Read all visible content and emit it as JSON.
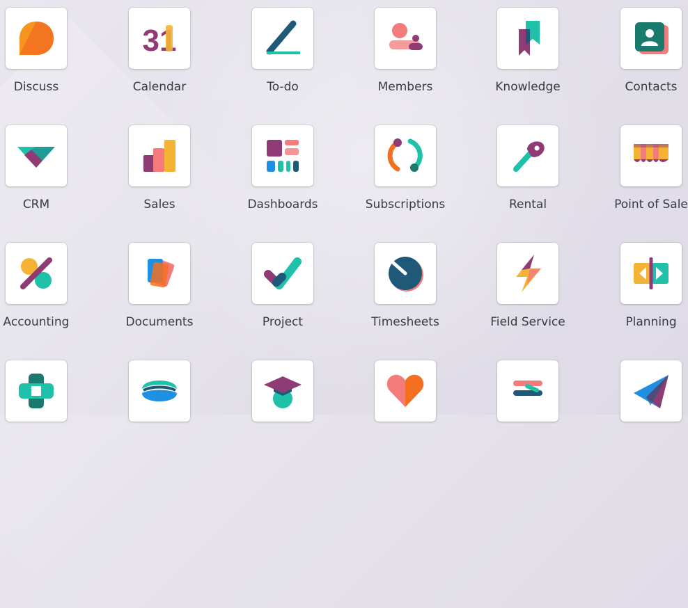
{
  "apps": [
    {
      "label": "Discuss",
      "icon": "discuss-icon"
    },
    {
      "label": "Calendar",
      "icon": "calendar-icon",
      "icon_text": "31"
    },
    {
      "label": "To-do",
      "icon": "todo-icon"
    },
    {
      "label": "Members",
      "icon": "members-icon"
    },
    {
      "label": "Knowledge",
      "icon": "knowledge-icon"
    },
    {
      "label": "Contacts",
      "icon": "contacts-icon"
    },
    {
      "label": "CRM",
      "icon": "crm-icon"
    },
    {
      "label": "Sales",
      "icon": "sales-icon"
    },
    {
      "label": "Dashboards",
      "icon": "dashboards-icon"
    },
    {
      "label": "Subscriptions",
      "icon": "subscriptions-icon"
    },
    {
      "label": "Rental",
      "icon": "rental-icon"
    },
    {
      "label": "Point of Sale",
      "icon": "point-of-sale-icon"
    },
    {
      "label": "Accounting",
      "icon": "accounting-icon"
    },
    {
      "label": "Documents",
      "icon": "documents-icon"
    },
    {
      "label": "Project",
      "icon": "project-icon"
    },
    {
      "label": "Timesheets",
      "icon": "timesheets-icon"
    },
    {
      "label": "Field Service",
      "icon": "field-service-icon"
    },
    {
      "label": "Planning",
      "icon": "planning-icon"
    },
    {
      "label": "",
      "icon": "medical-cross-icon"
    },
    {
      "label": "",
      "icon": "waves-icon"
    },
    {
      "label": "",
      "icon": "graduation-cap-icon"
    },
    {
      "label": "",
      "icon": "heart-icon"
    },
    {
      "label": "",
      "icon": "arrows-icon"
    },
    {
      "label": "",
      "icon": "paper-plane-icon"
    }
  ]
}
